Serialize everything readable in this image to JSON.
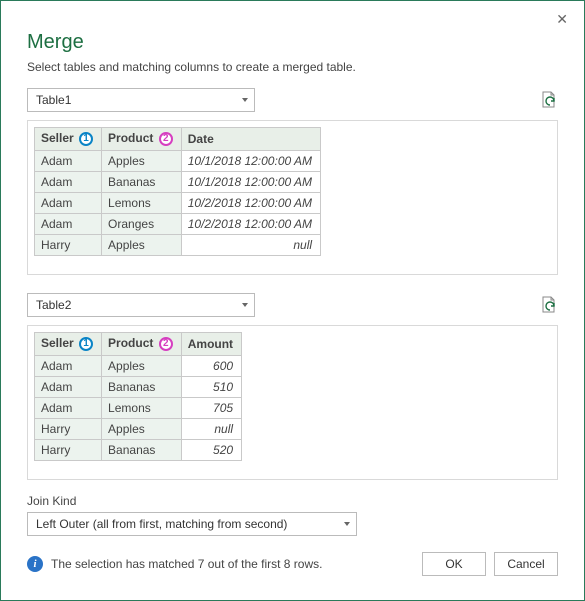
{
  "title": "Merge",
  "subtitle": "Select tables and matching columns to create a merged table.",
  "table1": {
    "select": "Table1",
    "headers": {
      "c0": "Seller",
      "c1": "Product",
      "c2": "Date",
      "b0": "1",
      "b1": "2"
    },
    "rows": [
      {
        "c0": "Adam",
        "c1": "Apples",
        "c2": "10/1/2018 12:00:00 AM"
      },
      {
        "c0": "Adam",
        "c1": "Bananas",
        "c2": "10/1/2018 12:00:00 AM"
      },
      {
        "c0": "Adam",
        "c1": "Lemons",
        "c2": "10/2/2018 12:00:00 AM"
      },
      {
        "c0": "Adam",
        "c1": "Oranges",
        "c2": "10/2/2018 12:00:00 AM"
      },
      {
        "c0": "Harry",
        "c1": "Apples",
        "c2": "null"
      }
    ]
  },
  "table2": {
    "select": "Table2",
    "headers": {
      "c0": "Seller",
      "c1": "Product",
      "c2": "Amount",
      "b0": "1",
      "b1": "2"
    },
    "rows": [
      {
        "c0": "Adam",
        "c1": "Apples",
        "c2": "600"
      },
      {
        "c0": "Adam",
        "c1": "Bananas",
        "c2": "510"
      },
      {
        "c0": "Adam",
        "c1": "Lemons",
        "c2": "705"
      },
      {
        "c0": "Harry",
        "c1": "Apples",
        "c2": "null"
      },
      {
        "c0": "Harry",
        "c1": "Bananas",
        "c2": "520"
      }
    ]
  },
  "join": {
    "label": "Join Kind",
    "value": "Left Outer (all from first, matching from second)"
  },
  "status": "The selection has matched 7 out of the first 8 rows.",
  "buttons": {
    "ok": "OK",
    "cancel": "Cancel"
  }
}
